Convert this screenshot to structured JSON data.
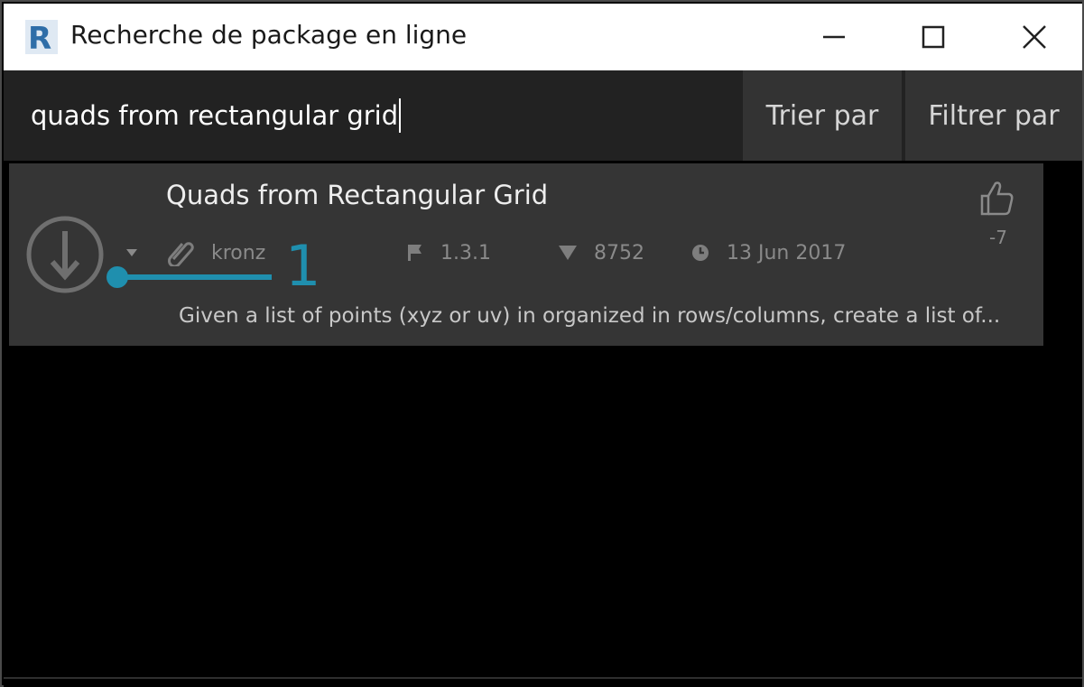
{
  "window": {
    "title": "Recherche de package en ligne",
    "app_icon": "revit-r-icon"
  },
  "window_controls": {
    "minimize": "minimize-icon",
    "maximize": "maximize-icon",
    "close": "close-icon"
  },
  "search": {
    "value": "quads from rectangular grid",
    "sort_label": "Trier par",
    "filter_label": "Filtrer par"
  },
  "results": [
    {
      "title": "Quads from Rectangular Grid",
      "author": "kronz",
      "version": "1.3.1",
      "downloads": "8752",
      "date": "13 Jun 2017",
      "votes": "-7",
      "description": "Given a list of points (xyz or uv) in organized in rows/columns, create a list of..."
    }
  ],
  "annotation": {
    "number": "1",
    "color": "#1f8fae"
  },
  "colors": {
    "background": "#000000",
    "search_bg": "#222222",
    "button_bg": "#333333",
    "card_bg": "#353535",
    "accent": "#1f8fae"
  }
}
